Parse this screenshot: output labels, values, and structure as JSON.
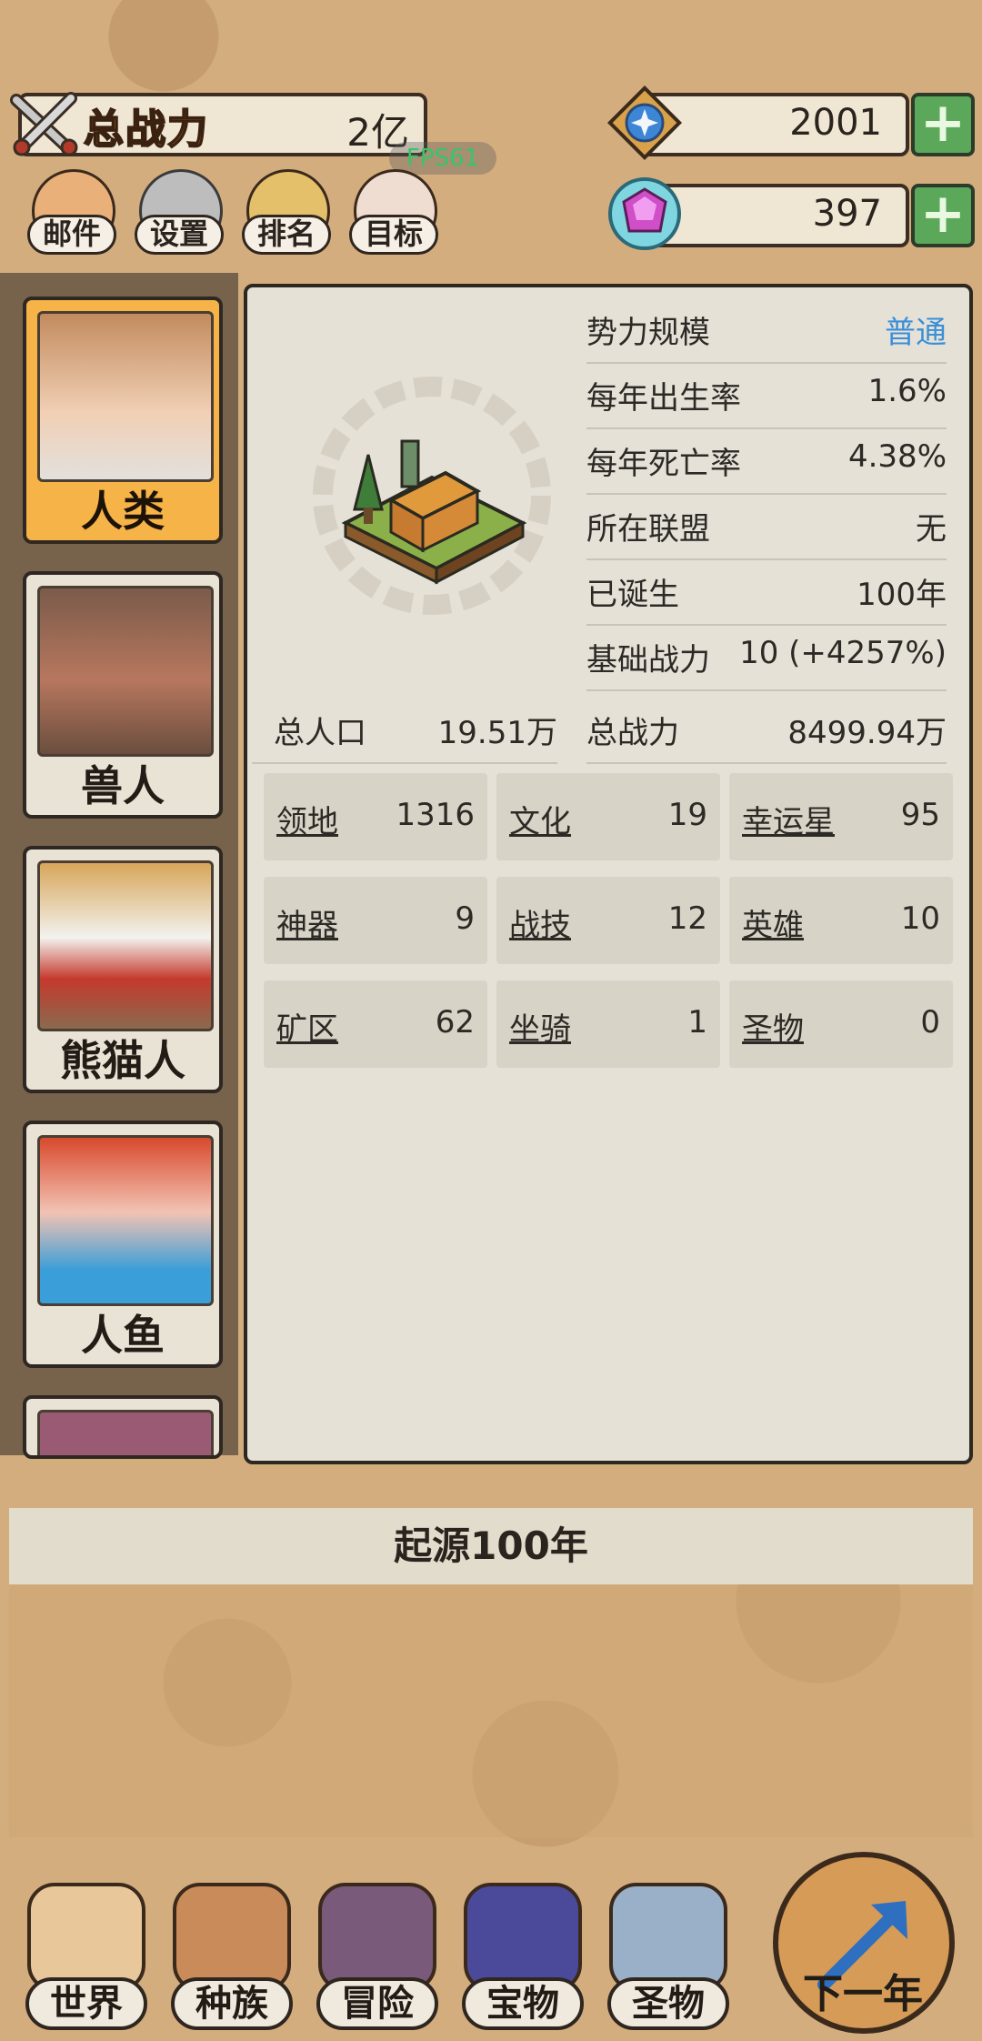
{
  "header": {
    "power_label": "总战力",
    "power_value": "2亿",
    "fps": "FPS61",
    "gold_value": "2001",
    "gem_value": "397",
    "plus": "+"
  },
  "menu": [
    {
      "label": "邮件",
      "icon": "mail-icon"
    },
    {
      "label": "设置",
      "icon": "gear-icon"
    },
    {
      "label": "排名",
      "icon": "ranking-icon"
    },
    {
      "label": "目标",
      "icon": "goal-scroll-icon"
    }
  ],
  "races": [
    {
      "name": "人类",
      "selected": true
    },
    {
      "name": "兽人",
      "selected": false
    },
    {
      "name": "熊猫人",
      "selected": false
    },
    {
      "name": "人鱼",
      "selected": false
    }
  ],
  "stats": [
    {
      "label": "势力规模",
      "value": "普通"
    },
    {
      "label": "每年出生率",
      "value": "1.6%"
    },
    {
      "label": "每年死亡率",
      "value": "4.38%"
    },
    {
      "label": "所在联盟",
      "value": "无"
    },
    {
      "label": "已诞生",
      "value": "100年"
    },
    {
      "label": "基础战力",
      "value": "10 (+4257%)"
    },
    {
      "label": "总战力",
      "value": "8499.94万"
    }
  ],
  "population": {
    "label": "总人口",
    "value": "19.51万"
  },
  "grid": [
    {
      "label": "领地",
      "value": "1316"
    },
    {
      "label": "文化",
      "value": "19"
    },
    {
      "label": "幸运星",
      "value": "95"
    },
    {
      "label": "神器",
      "value": "9"
    },
    {
      "label": "战技",
      "value": "12"
    },
    {
      "label": "英雄",
      "value": "10"
    },
    {
      "label": "矿区",
      "value": "62"
    },
    {
      "label": "坐骑",
      "value": "1"
    },
    {
      "label": "圣物",
      "value": "0"
    }
  ],
  "origin": "起源100年",
  "nav": [
    {
      "label": "世界",
      "icon": "world-map-icon"
    },
    {
      "label": "种族",
      "icon": "race-icon"
    },
    {
      "label": "冒险",
      "icon": "adventure-icon"
    },
    {
      "label": "宝物",
      "icon": "treasure-chest-icon"
    },
    {
      "label": "圣物",
      "icon": "relic-icon"
    }
  ],
  "next_label": "下一年",
  "colors": {
    "accent_gold": "#f6b347",
    "link_blue": "#3a8fd8",
    "plus_green": "#5ba85a"
  }
}
